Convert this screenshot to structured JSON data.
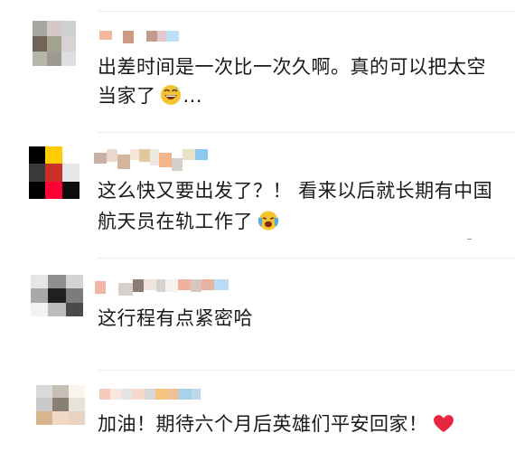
{
  "comments": [
    {
      "text": "出差时间是一次比一次久啊。真的可以把太空当家了",
      "emoji_icon": "grinning-sweat-face-icon",
      "trailing": "...",
      "colors": {
        "avatar": [
          "#a7a7a0",
          "#d3c8c6",
          "#cdd1d0",
          "#6e6558",
          "#9fa48b",
          "#d7d2d6",
          "#b5b6a9",
          "#9f9a91",
          "#dfdfe1"
        ],
        "name": [
          "#f3b99e",
          "#ffffff",
          "#cf9a82",
          "#ffffff",
          "#c29a8e",
          "#e3c7c9",
          "#bfe0f4"
        ]
      }
    },
    {
      "text": "这么快又要出发了？！ 看来以后就长期有中国航天员在轨工作了",
      "emoji_icon": "crying-face-icon",
      "trailing": "",
      "colors": {
        "avatar": [
          "#000000",
          "#ffcc00",
          "#ffffff",
          "#3a3a3a",
          "#c9302a",
          "#e7e7e7",
          "#000000",
          "#ff0033",
          "#0c0c0c"
        ],
        "name": [
          "#c9b0a6",
          "#ead9cf",
          "#d6b59f",
          "#f6e6d4",
          "#e0c79e",
          "#efe8e2",
          "#f5b58c",
          "#d5d0c7",
          "#eae1ca",
          "#8ec7ef"
        ]
      }
    },
    {
      "text": "这行程有点紧密哈",
      "emoji_icon": "",
      "trailing": "",
      "colors": {
        "avatar": [
          "#e6e6e6",
          "#8f8f8f",
          "#d3d3d3",
          "#a9a9a9",
          "#202020",
          "#7c7c7c",
          "#f2f2f2",
          "#bdbdbd",
          "#4a4a4a"
        ],
        "name": [
          "#f0b8a4",
          "#ffffff",
          "#d8cfc9",
          "#8c7b72",
          "#efe3dd",
          "#d3d3d3",
          "#f7f2ee",
          "#f0b29a",
          "#d7c7c0",
          "#e7b2a0",
          "#b9dcf4"
        ]
      }
    },
    {
      "text": "加油！期待六个月后英雄们平安回家！",
      "emoji_icon": "red-heart-icon",
      "trailing": "",
      "colors": {
        "avatar": [
          "#d9d9d9",
          "#c6bfb4",
          "#faf4ec",
          "#c9c9c9",
          "#8a8072",
          "#e7e2da",
          "#d8b48f",
          "#f0d8c5",
          "#e8d3c2"
        ],
        "name": [
          "#f5c8b9",
          "#fbe6de",
          "#e4e4e4",
          "#f7d8cd",
          "#d7d7d7",
          "#f7c57f",
          "#efc198",
          "#a8d2ea",
          "#bcd8ea"
        ]
      }
    }
  ]
}
